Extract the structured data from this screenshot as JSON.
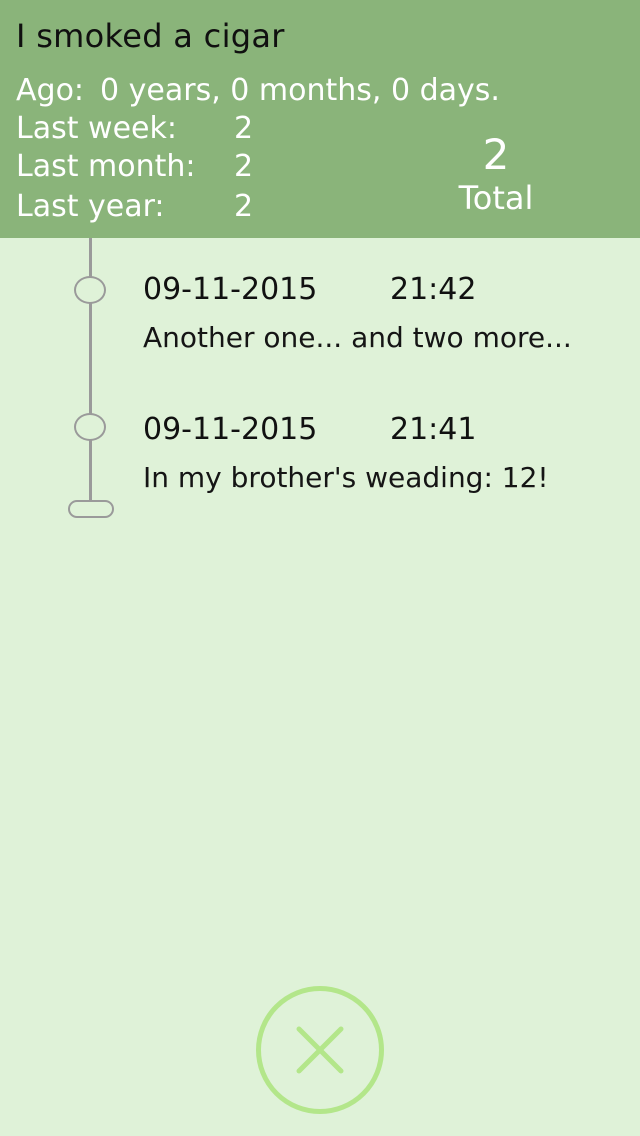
{
  "header": {
    "title": "I smoked a cigar",
    "ago_label": "Ago:",
    "ago_value": "0 years, 0 months, 0 days.",
    "stats": {
      "last_week_label": "Last week:",
      "last_week_value": "2",
      "last_month_label": "Last month:",
      "last_month_value": "2",
      "last_year_label": "Last year:",
      "last_year_value": "2"
    },
    "total_count": "2",
    "total_label": "Total"
  },
  "entries": [
    {
      "date": "09-11-2015",
      "time": "21:42",
      "note": "Another one... and two more..."
    },
    {
      "date": "09-11-2015",
      "time": "21:41",
      "note": "In my brother's weading: 12!"
    }
  ],
  "close_button": {
    "icon": "close-icon"
  },
  "colors": {
    "header_bg": "#8ab47a",
    "page_bg": "#dff2d8",
    "timeline": "#9a9a9a",
    "close_accent": "#b3e68a"
  }
}
